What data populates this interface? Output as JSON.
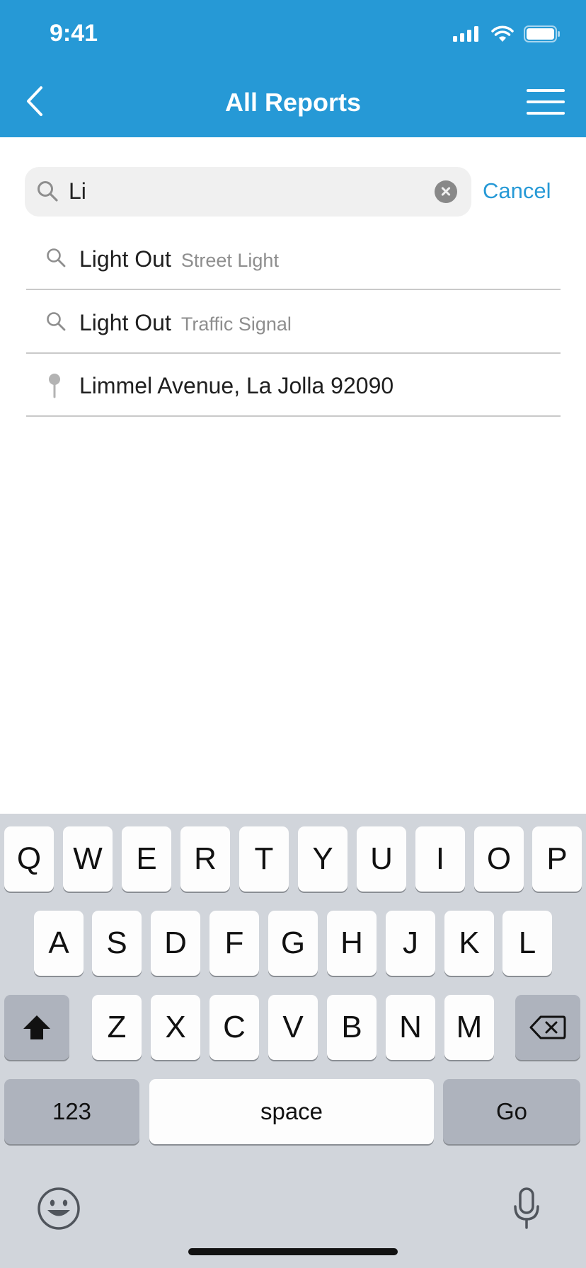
{
  "status_bar": {
    "time": "9:41",
    "icons": [
      "signal-icon",
      "wifi-icon",
      "battery-icon"
    ]
  },
  "nav": {
    "title": "All Reports",
    "back_icon": "chevron-left-icon",
    "menu_icon": "hamburger-menu-icon"
  },
  "search": {
    "value": "Li",
    "icon": "search-icon",
    "clear_icon": "clear-icon",
    "cancel_label": "Cancel"
  },
  "results": [
    {
      "icon": "search-icon",
      "title": "Light Out",
      "subtitle": "Street Light"
    },
    {
      "icon": "search-icon",
      "title": "Light Out",
      "subtitle": "Traffic Signal"
    },
    {
      "icon": "map-pin-icon",
      "title": "Limmel Avenue, La Jolla 92090",
      "subtitle": ""
    }
  ],
  "keyboard": {
    "row1": [
      "Q",
      "W",
      "E",
      "R",
      "T",
      "Y",
      "U",
      "I",
      "O",
      "P"
    ],
    "row2": [
      "A",
      "S",
      "D",
      "F",
      "G",
      "H",
      "J",
      "K",
      "L"
    ],
    "row3": [
      "Z",
      "X",
      "C",
      "V",
      "B",
      "N",
      "M"
    ],
    "numbers_label": "123",
    "space_label": "space",
    "go_label": "Go",
    "shift_icon": "shift-icon",
    "delete_icon": "backspace-icon",
    "emoji_icon": "emoji-icon",
    "mic_icon": "microphone-icon"
  },
  "colors": {
    "accent": "#2699d6",
    "keyboard_bg": "#d1d5db",
    "key_bg": "#fdfdfd",
    "key_dark_bg": "#aeb3bd"
  }
}
